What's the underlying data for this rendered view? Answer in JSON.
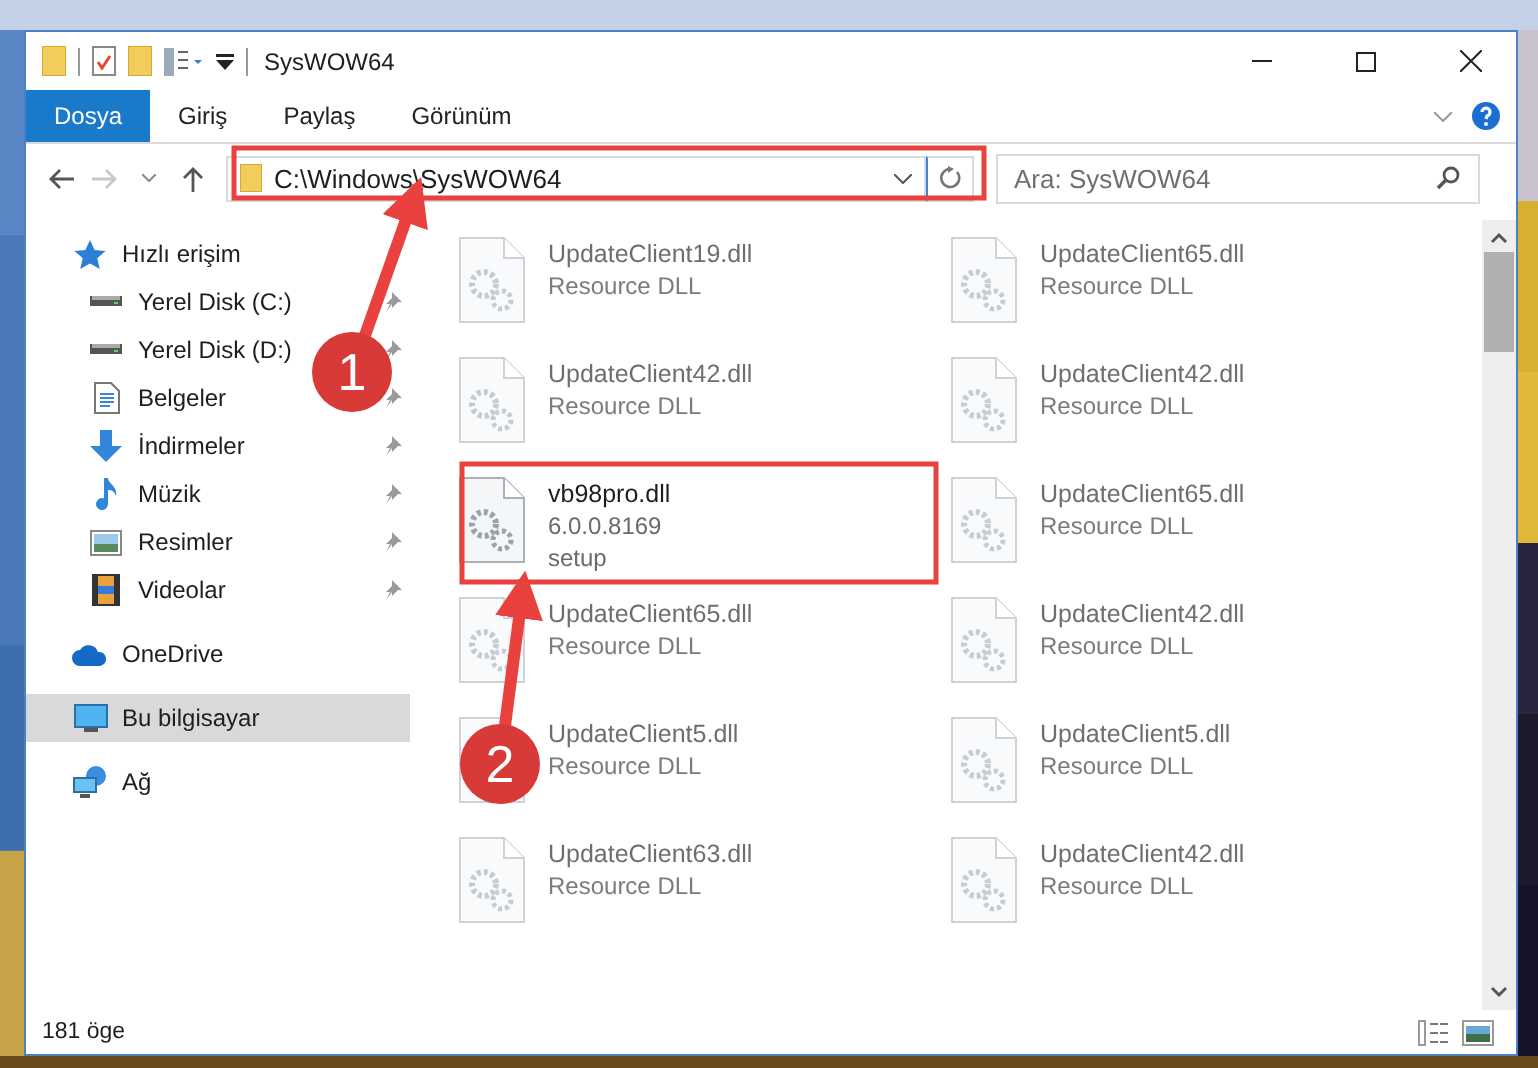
{
  "window": {
    "title": "SysWOW64"
  },
  "ribbon_tabs": [
    {
      "label": "Dosya",
      "selected": true
    },
    {
      "label": "Giriş",
      "selected": false
    },
    {
      "label": "Paylaş",
      "selected": false
    },
    {
      "label": "Görünüm",
      "selected": false
    }
  ],
  "address_bar": {
    "value": "C:\\Windows\\SysWOW64"
  },
  "search": {
    "placeholder": "Ara: SysWOW64"
  },
  "sidebar": {
    "sections": [
      {
        "label": "Hızlı erişim",
        "kind": "star",
        "selected": false,
        "children": [
          {
            "label": "Yerel Disk (C:)",
            "kind": "drive",
            "pinned": true
          },
          {
            "label": "Yerel Disk (D:)",
            "kind": "drive",
            "pinned": true
          },
          {
            "label": "Belgeler",
            "kind": "documents",
            "pinned": true
          },
          {
            "label": "İndirmeler",
            "kind": "downloads",
            "pinned": true
          },
          {
            "label": "Müzik",
            "kind": "music",
            "pinned": true
          },
          {
            "label": "Resimler",
            "kind": "pictures",
            "pinned": true
          },
          {
            "label": "Videolar",
            "kind": "videos",
            "pinned": true
          }
        ]
      },
      {
        "label": "OneDrive",
        "kind": "cloud",
        "selected": false
      },
      {
        "label": "Bu bilgisayar",
        "kind": "computer",
        "selected": true
      },
      {
        "label": "Ağ",
        "kind": "network",
        "selected": false
      }
    ]
  },
  "files": [
    {
      "name": "UpdateClient19.dll",
      "details": [
        "Resource DLL"
      ],
      "blurred": true
    },
    {
      "name": "UpdateClient65.dll",
      "details": [
        "Resource DLL"
      ],
      "blurred": true
    },
    {
      "name": "UpdateClient42.dll",
      "details": [
        "Resource DLL"
      ],
      "blurred": true
    },
    {
      "name": "UpdateClient42.dll",
      "details": [
        "Resource DLL"
      ],
      "blurred": true
    },
    {
      "name": "vb98pro.dll",
      "details": [
        "6.0.0.8169",
        "setup"
      ],
      "blurred": false
    },
    {
      "name": "UpdateClient65.dll",
      "details": [
        "Resource DLL"
      ],
      "blurred": true
    },
    {
      "name": "UpdateClient65.dll",
      "details": [
        "Resource DLL"
      ],
      "blurred": true
    },
    {
      "name": "UpdateClient42.dll",
      "details": [
        "Resource DLL"
      ],
      "blurred": true
    },
    {
      "name": "UpdateClient5.dll",
      "details": [
        "Resource DLL"
      ],
      "blurred": true
    },
    {
      "name": "UpdateClient5.dll",
      "details": [
        "Resource DLL"
      ],
      "blurred": true
    },
    {
      "name": "UpdateClient63.dll",
      "details": [
        "Resource DLL"
      ],
      "blurred": true
    },
    {
      "name": "UpdateClient42.dll",
      "details": [
        "Resource DLL"
      ],
      "blurred": true
    }
  ],
  "status_bar": {
    "item_count": "181 öge"
  },
  "annotations": [
    {
      "kind": "box"
    },
    {
      "kind": "box"
    },
    {
      "kind": "step",
      "label": "1"
    },
    {
      "kind": "step",
      "label": "2"
    }
  ]
}
